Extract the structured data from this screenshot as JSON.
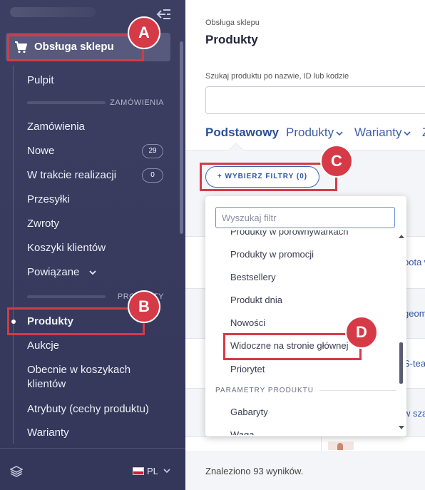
{
  "sidebar": {
    "active_section": "Obsługa sklepu",
    "items": {
      "pulpit": "Pulpit",
      "zamowienia": "Zamówienia",
      "nowe": "Nowe",
      "nowe_count": "29",
      "w_trakcie": "W trakcie realizacji",
      "w_trakcie_count": "0",
      "przesylki": "Przesyłki",
      "zwroty": "Zwroty",
      "koszyki": "Koszyki klientów",
      "powiazane": "Powiązane",
      "produkty": "Produkty",
      "aukcje": "Aukcje",
      "obecnie_line1": "Obecnie w koszykach",
      "obecnie_line2": "klientów",
      "atrybuty": "Atrybuty (cechy produktu)",
      "warianty": "Warianty"
    },
    "dividers": {
      "zamowienia": "ZAMÓWIENIA",
      "produkty": "PRODUKTY"
    },
    "language": "PL"
  },
  "main": {
    "breadcrumb": "Obsługa sklepu",
    "title": "Produkty",
    "search_label": "Szukaj produktu po nazwie, ID lub kodzie",
    "search_value": "",
    "tabs": [
      {
        "label": "Podstawowy"
      },
      {
        "label": "Produkty"
      },
      {
        "label": "Warianty"
      },
      {
        "label": "Z"
      }
    ],
    "filter_button": "+ WYBIERZ FILTRY (0)",
    "results": "Znaleziono 93 wyników.",
    "bg_links": [
      "bota w",
      "geom",
      "S-tean",
      "w sza"
    ]
  },
  "dropdown": {
    "search_placeholder": "Wyszukaj filtr",
    "options": {
      "porownywarki": "Produkty w porównywarkach",
      "promocja": "Produkty w promocji",
      "bestsellery": "Bestsellery",
      "produkt_dnia": "Produkt dnia",
      "nowosci": "Nowości",
      "widoczne": "Widoczne na stronie głównej",
      "priorytet": "Priorytet",
      "gabaryty": "Gabaryty",
      "waga": "Waga"
    },
    "group_header": "PARAMETRY PRODUKTU"
  },
  "callouts": {
    "a": "A",
    "b": "B",
    "c": "C",
    "d": "D"
  },
  "colors": {
    "sidebar_bg": "#3c3e62",
    "accent": "#2f56a8",
    "callout": "#d63a47"
  }
}
